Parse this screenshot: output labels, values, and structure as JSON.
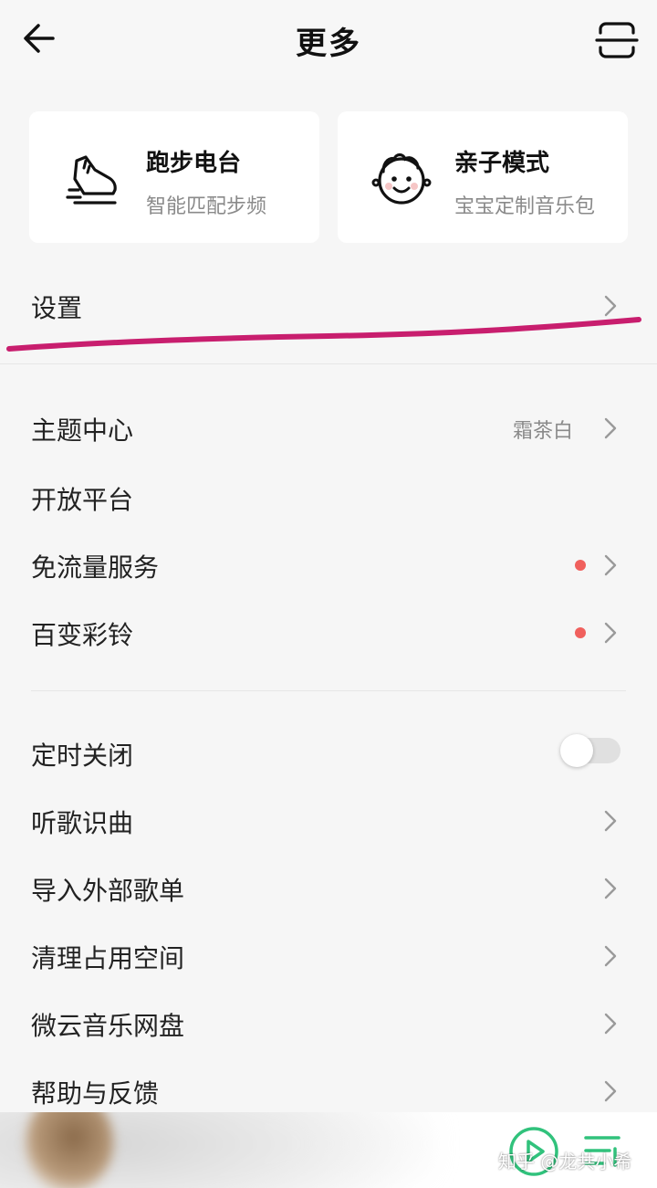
{
  "header": {
    "title": "更多"
  },
  "cards": [
    {
      "title": "跑步电台",
      "subtitle": "智能匹配步频",
      "icon": "running-shoe-icon"
    },
    {
      "title": "亲子模式",
      "subtitle": "宝宝定制音乐包",
      "icon": "baby-face-icon"
    }
  ],
  "settings": {
    "label": "设置"
  },
  "group1": [
    {
      "label": "主题中心",
      "value": "霜茶白"
    },
    {
      "label": "开放平台"
    },
    {
      "label": "免流量服务"
    },
    {
      "label": "百变彩铃"
    }
  ],
  "group2": [
    {
      "label": "定时关闭"
    },
    {
      "label": "听歌识曲"
    },
    {
      "label": "导入外部歌单"
    },
    {
      "label": "清理占用空间"
    },
    {
      "label": "微云音乐网盘"
    },
    {
      "label": "帮助与反馈"
    }
  ],
  "watermark": "知乎 @龙共小希",
  "colors": {
    "accent_green": "#31c27c",
    "red_dot": "#f0605d",
    "highlight_stroke": "#c81e6e"
  },
  "toggles": {
    "sleep_timer": false
  }
}
